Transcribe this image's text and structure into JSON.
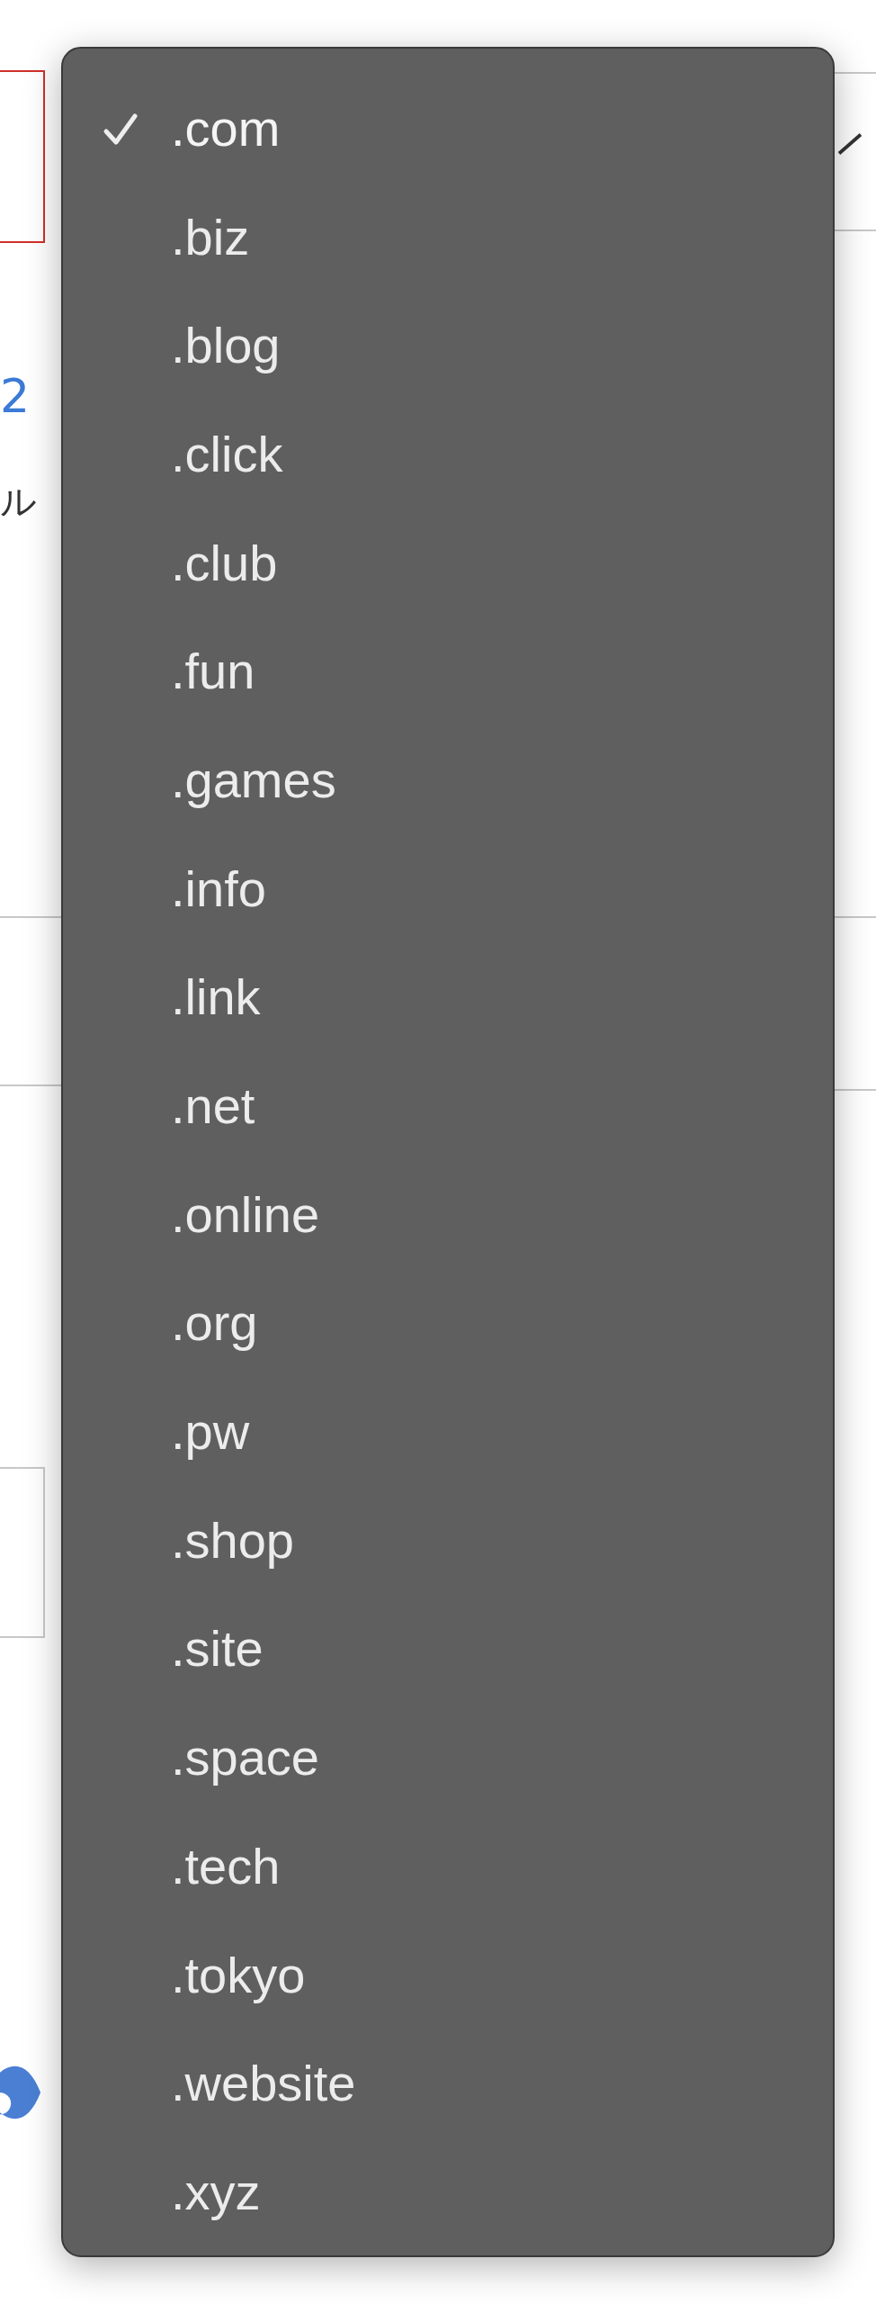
{
  "page": {
    "link_fragment": "2",
    "text_fragment": "ル"
  },
  "menu": {
    "items": [
      {
        "label": ".com",
        "selected": true
      },
      {
        "label": ".biz",
        "selected": false
      },
      {
        "label": ".blog",
        "selected": false
      },
      {
        "label": ".click",
        "selected": false
      },
      {
        "label": ".club",
        "selected": false
      },
      {
        "label": ".fun",
        "selected": false
      },
      {
        "label": ".games",
        "selected": false
      },
      {
        "label": ".info",
        "selected": false
      },
      {
        "label": ".link",
        "selected": false
      },
      {
        "label": ".net",
        "selected": false
      },
      {
        "label": ".online",
        "selected": false
      },
      {
        "label": ".org",
        "selected": false
      },
      {
        "label": ".pw",
        "selected": false
      },
      {
        "label": ".shop",
        "selected": false
      },
      {
        "label": ".site",
        "selected": false
      },
      {
        "label": ".space",
        "selected": false
      },
      {
        "label": ".tech",
        "selected": false
      },
      {
        "label": ".tokyo",
        "selected": false
      },
      {
        "label": ".website",
        "selected": false
      },
      {
        "label": ".xyz",
        "selected": false
      }
    ]
  }
}
